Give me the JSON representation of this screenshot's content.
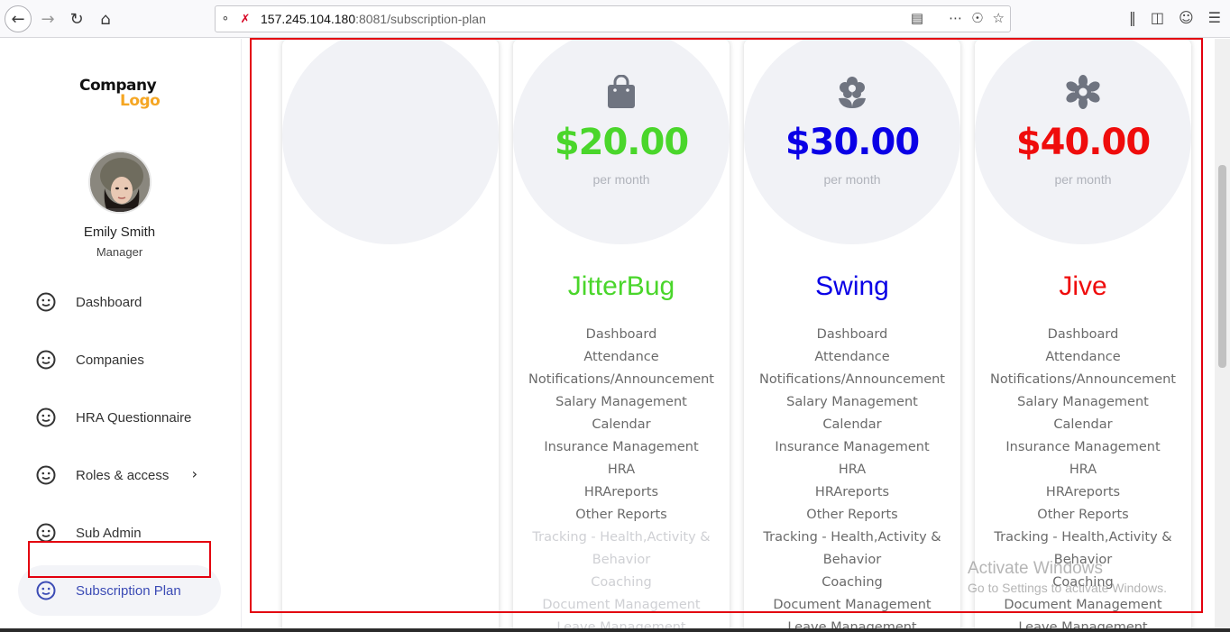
{
  "browser": {
    "url_host": "157.245.104.180",
    "url_rest": ":8081/subscription-plan",
    "icons": [
      "back-arrow-icon",
      "forward-arrow-icon",
      "reload-icon",
      "home-icon",
      "shield-icon",
      "insecure-lock-icon",
      "reader-view-icon",
      "more-icon",
      "pocket-icon",
      "bookmark-star-icon",
      "library-icon",
      "sidebar-icon",
      "account-icon",
      "menu-icon"
    ]
  },
  "sidebar": {
    "logo": {
      "line1": "Company",
      "line2": "Logo"
    },
    "user": {
      "name": "Emily Smith",
      "role": "Manager"
    },
    "items": [
      {
        "label": "Dashboard",
        "icon": "smiley-icon"
      },
      {
        "label": "Companies",
        "icon": "smiley-icon"
      },
      {
        "label": "HRA Questionnaire",
        "icon": "smiley-icon"
      },
      {
        "label": "Roles & access",
        "icon": "smiley-icon",
        "has_chevron": true
      },
      {
        "label": "Sub Admin",
        "icon": "smiley-icon"
      },
      {
        "label": "Subscription Plan",
        "icon": "smiley-icon",
        "active": true
      }
    ]
  },
  "plans": [
    {
      "price": "$20.00",
      "period": "per month",
      "name": "JitterBug",
      "color": "#4ad62b",
      "icon": "shopping-bag-icon",
      "features": [
        "Dashboard",
        "Attendance",
        "Notifications/Announcement",
        "Salary Management",
        "Calendar",
        "Insurance Management",
        "HRA",
        "HRAreports",
        "Other Reports",
        "Tracking - Health,Activity &",
        "Behavior",
        "Coaching",
        "Document Management",
        "Leave Management"
      ]
    },
    {
      "price": "$30.00",
      "period": "per month",
      "name": "Swing",
      "color": "#0a00e6",
      "icon": "flower-icon",
      "features": [
        "Dashboard",
        "Attendance",
        "Notifications/Announcement",
        "Salary Management",
        "Calendar",
        "Insurance Management",
        "HRA",
        "HRAreports",
        "Other Reports",
        "Tracking - Health,Activity &",
        "Behavior",
        "Coaching",
        "Document Management",
        "Leave Management"
      ]
    },
    {
      "price": "$40.00",
      "period": "per month",
      "name": "Jive",
      "color": "#ef0c0c",
      "icon": "cog-flower-icon",
      "features": [
        "Dashboard",
        "Attendance",
        "Notifications/Announcement",
        "Salary Management",
        "Calendar",
        "Insurance Management",
        "HRA",
        "HRAreports",
        "Other Reports",
        "Tracking - Health,Activity &",
        "Behavior",
        "Coaching",
        "Document Management",
        "Leave Management"
      ]
    }
  ],
  "watermark": {
    "line1": "Activate Windows",
    "line2": "Go to Settings to activate Windows."
  }
}
